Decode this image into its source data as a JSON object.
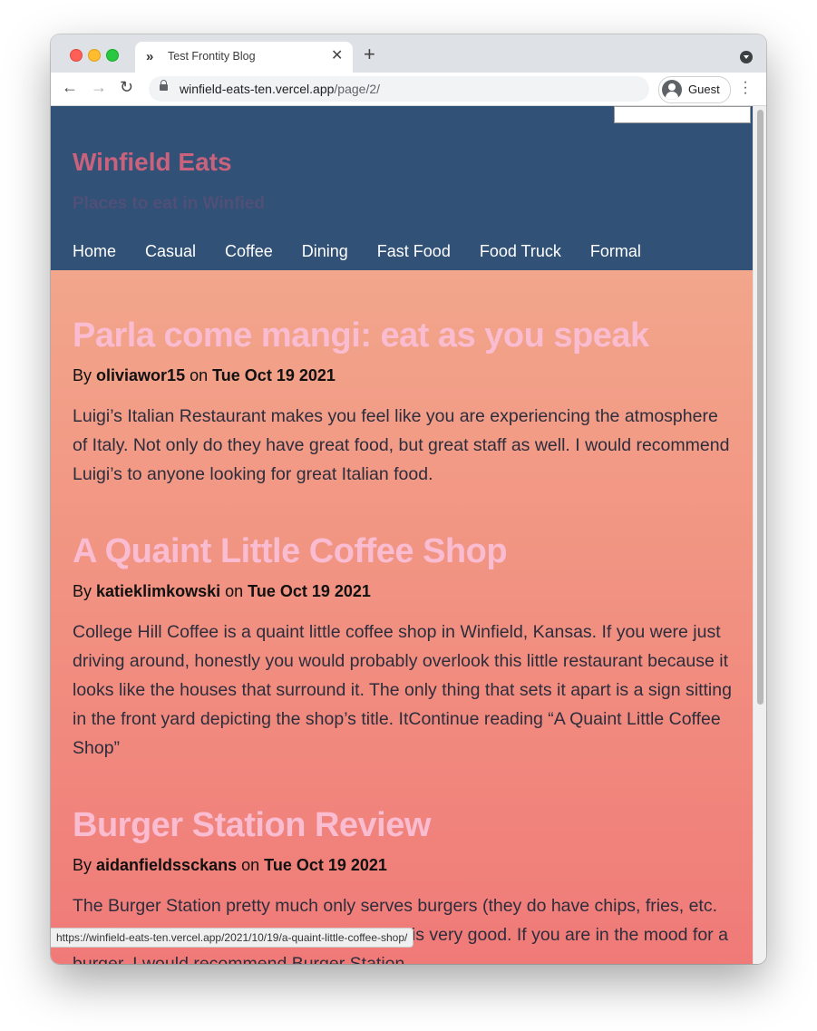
{
  "browser": {
    "tab_title": "Test Frontity Blog",
    "tab_icon": "»",
    "new_tab": "+",
    "url_host": "winfield-eats-ten.vercel.app",
    "url_path": "/page/2/",
    "profile_label": "Guest",
    "status_url": "https://winfield-eats-ten.vercel.app/2021/10/19/a-quaint-little-coffee-shop/"
  },
  "site": {
    "title": "Winfield Eats",
    "description": "Places to eat in Winfied",
    "menu": [
      "Home",
      "Casual",
      "Coffee",
      "Dining",
      "Fast Food",
      "Food Truck",
      "Formal"
    ]
  },
  "posts": [
    {
      "title": "Parla come mangi: eat as you speak",
      "by": "By",
      "author": "oliviawor15",
      "on": "on",
      "date": "Tue Oct 19 2021",
      "excerpt": "Luigi’s Italian Restaurant makes you feel like you are experiencing the atmosphere of Italy. Not only do they have great food, but great staff as well. I would recommend Luigi’s to anyone looking for great Italian food."
    },
    {
      "title": "A Quaint Little Coffee Shop",
      "by": "By",
      "author": "katieklimkowski",
      "on": "on",
      "date": "Tue Oct 19 2021",
      "excerpt": "College Hill Coffee is a quaint little coffee shop in Winfield, Kansas. If you were just driving around, honestly you would probably overlook this little restaurant because it looks like the houses that surround it. The only thing that sets it apart is a sign sitting in the front yard depicting the shop’s title. ItContinue reading “A Quaint Little Coffee Shop”"
    },
    {
      "title": "Burger Station Review",
      "by": "By",
      "author": "aidanfieldssckans",
      "on": "on",
      "date": "Tue Oct 19 2021",
      "excerpt": "The Burger Station pretty much only serves burgers (they do have chips, fries, etc. for sides). While it is only burgers, the food is very good. If you are in the mood for a burger, I would recommend Burger Station."
    }
  ]
}
